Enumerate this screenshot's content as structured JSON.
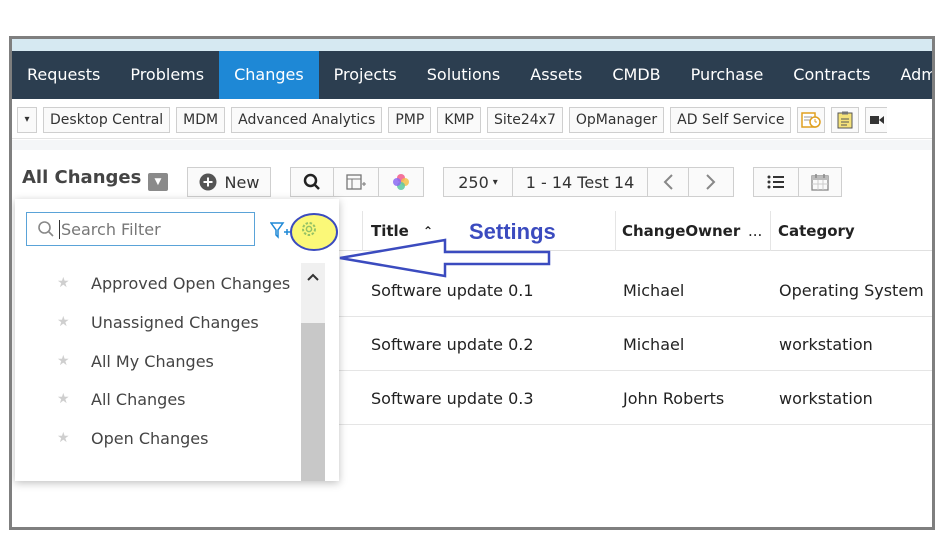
{
  "nav": {
    "items": [
      {
        "label": "Requests",
        "active": false
      },
      {
        "label": "Problems",
        "active": false
      },
      {
        "label": "Changes",
        "active": true
      },
      {
        "label": "Projects",
        "active": false
      },
      {
        "label": "Solutions",
        "active": false
      },
      {
        "label": "Assets",
        "active": false
      },
      {
        "label": "CMDB",
        "active": false
      },
      {
        "label": "Purchase",
        "active": false
      },
      {
        "label": "Contracts",
        "active": false
      },
      {
        "label": "Adm",
        "active": false
      }
    ]
  },
  "integrations": {
    "items": [
      "Desktop Central",
      "MDM",
      "Advanced Analytics",
      "PMP",
      "KMP",
      "Site24x7",
      "OpManager",
      "AD Self Service"
    ]
  },
  "view": {
    "title": "All Changes",
    "new_label": "New",
    "per_page": "250",
    "range": "1 - 14 Test 14"
  },
  "filter": {
    "placeholder": "Search Filter",
    "items": [
      "Approved Open Changes",
      "Unassigned Changes",
      "All My Changes",
      "All Changes",
      "Open Changes"
    ]
  },
  "table": {
    "headers": {
      "title": "Title",
      "owner": "ChangeOwner",
      "owner_more": "...",
      "category": "Category"
    },
    "rows": [
      {
        "title": "Software update 0.1",
        "owner": "Michael",
        "category": "Operating System"
      },
      {
        "title": "Software update 0.2",
        "owner": "Michael",
        "category": "workstation"
      },
      {
        "title": "Software update 0.3",
        "owner": "John Roberts",
        "category": "workstation"
      }
    ]
  },
  "annotation": {
    "label": "Settings",
    "highlight_color": "#f7f20a",
    "text_color": "#3b4bbf"
  },
  "colors": {
    "nav_bg": "#2c3e50",
    "nav_active": "#1e88d6",
    "accent": "#1e88d6"
  }
}
